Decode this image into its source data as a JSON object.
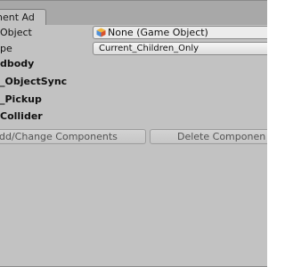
{
  "tab": {
    "title": "nent Ad"
  },
  "fields": {
    "object_label": "Object",
    "object_value": "None (Game Object)",
    "type_label": "pe",
    "type_value": "Current_Children_Only"
  },
  "components": [
    "dbody",
    "_ObjectSync",
    "_Pickup",
    "Collider"
  ],
  "buttons": {
    "add_change": "dd/Change Components",
    "delete": "Delete Componen"
  },
  "icons": {
    "object_field": "game-object-cube-icon"
  }
}
